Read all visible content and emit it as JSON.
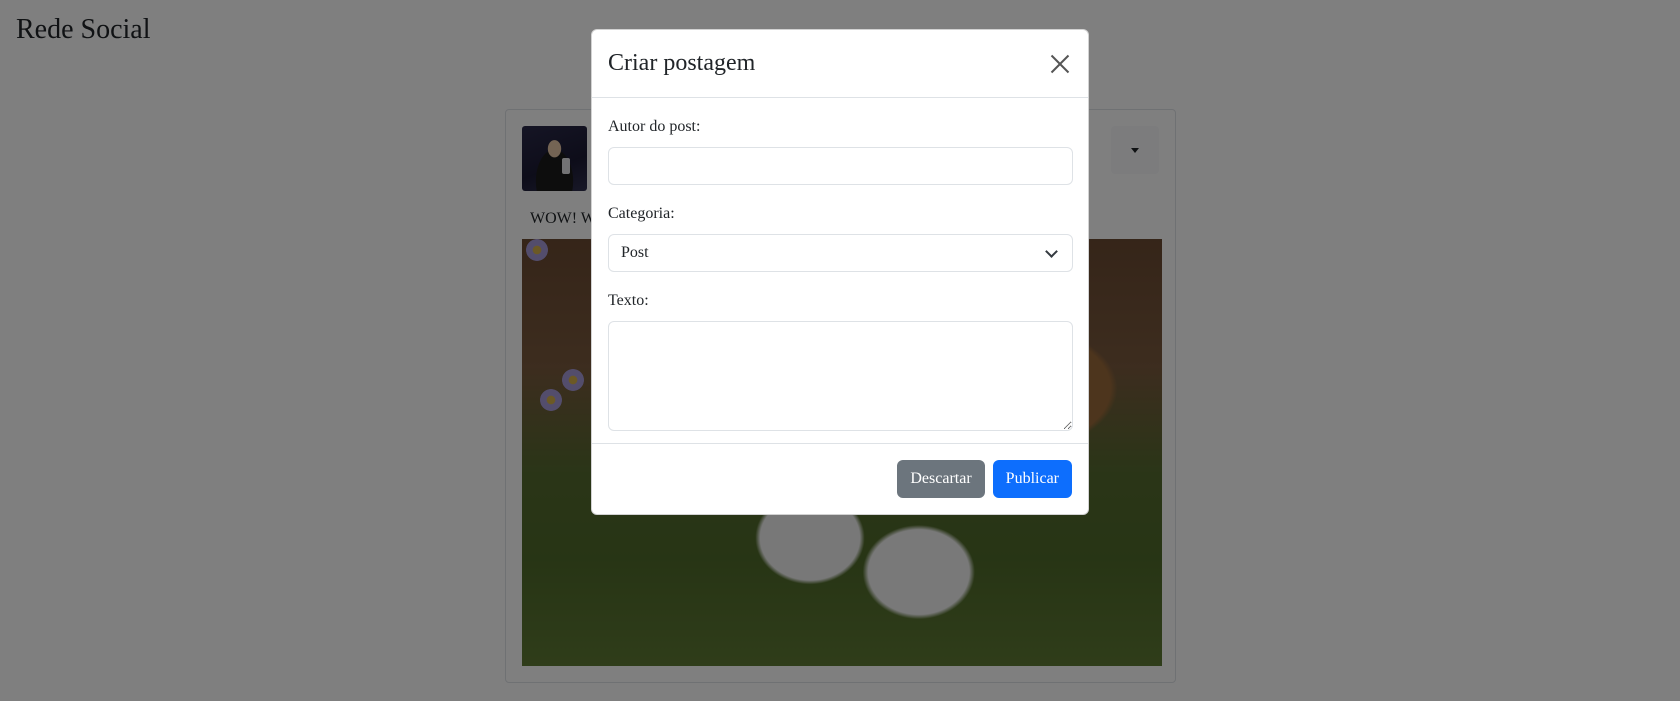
{
  "app": {
    "title": "Rede Social"
  },
  "post": {
    "text": "WOW! W",
    "avatar_alt": "author avatar"
  },
  "modal": {
    "title": "Criar postagem",
    "author_label": "Autor do post:",
    "author_value": "",
    "category_label": "Categoria:",
    "category_selected": "Post",
    "text_label": "Texto:",
    "text_value": "",
    "discard_label": "Descartar",
    "publish_label": "Publicar"
  },
  "colors": {
    "primary": "#0d6efd",
    "secondary": "#6c757d",
    "backdrop": "rgba(0,0,0,0.5)"
  },
  "icons": [
    "close-icon",
    "chevron-down-icon",
    "caret-down-icon"
  ]
}
